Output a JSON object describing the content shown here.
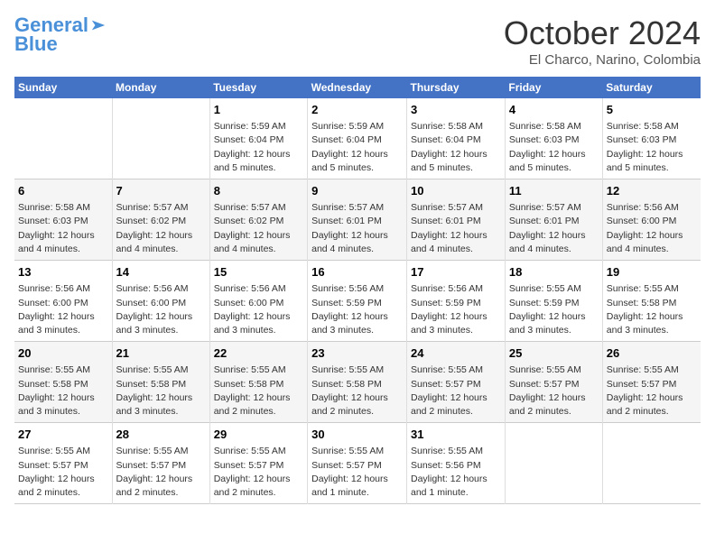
{
  "header": {
    "logo_line1": "General",
    "logo_line2": "Blue",
    "month_title": "October 2024",
    "location": "El Charco, Narino, Colombia"
  },
  "days_of_week": [
    "Sunday",
    "Monday",
    "Tuesday",
    "Wednesday",
    "Thursday",
    "Friday",
    "Saturday"
  ],
  "weeks": [
    [
      {
        "day": "",
        "info": ""
      },
      {
        "day": "",
        "info": ""
      },
      {
        "day": "1",
        "info": "Sunrise: 5:59 AM\nSunset: 6:04 PM\nDaylight: 12 hours and 5 minutes."
      },
      {
        "day": "2",
        "info": "Sunrise: 5:59 AM\nSunset: 6:04 PM\nDaylight: 12 hours and 5 minutes."
      },
      {
        "day": "3",
        "info": "Sunrise: 5:58 AM\nSunset: 6:04 PM\nDaylight: 12 hours and 5 minutes."
      },
      {
        "day": "4",
        "info": "Sunrise: 5:58 AM\nSunset: 6:03 PM\nDaylight: 12 hours and 5 minutes."
      },
      {
        "day": "5",
        "info": "Sunrise: 5:58 AM\nSunset: 6:03 PM\nDaylight: 12 hours and 5 minutes."
      }
    ],
    [
      {
        "day": "6",
        "info": "Sunrise: 5:58 AM\nSunset: 6:03 PM\nDaylight: 12 hours and 4 minutes."
      },
      {
        "day": "7",
        "info": "Sunrise: 5:57 AM\nSunset: 6:02 PM\nDaylight: 12 hours and 4 minutes."
      },
      {
        "day": "8",
        "info": "Sunrise: 5:57 AM\nSunset: 6:02 PM\nDaylight: 12 hours and 4 minutes."
      },
      {
        "day": "9",
        "info": "Sunrise: 5:57 AM\nSunset: 6:01 PM\nDaylight: 12 hours and 4 minutes."
      },
      {
        "day": "10",
        "info": "Sunrise: 5:57 AM\nSunset: 6:01 PM\nDaylight: 12 hours and 4 minutes."
      },
      {
        "day": "11",
        "info": "Sunrise: 5:57 AM\nSunset: 6:01 PM\nDaylight: 12 hours and 4 minutes."
      },
      {
        "day": "12",
        "info": "Sunrise: 5:56 AM\nSunset: 6:00 PM\nDaylight: 12 hours and 4 minutes."
      }
    ],
    [
      {
        "day": "13",
        "info": "Sunrise: 5:56 AM\nSunset: 6:00 PM\nDaylight: 12 hours and 3 minutes."
      },
      {
        "day": "14",
        "info": "Sunrise: 5:56 AM\nSunset: 6:00 PM\nDaylight: 12 hours and 3 minutes."
      },
      {
        "day": "15",
        "info": "Sunrise: 5:56 AM\nSunset: 6:00 PM\nDaylight: 12 hours and 3 minutes."
      },
      {
        "day": "16",
        "info": "Sunrise: 5:56 AM\nSunset: 5:59 PM\nDaylight: 12 hours and 3 minutes."
      },
      {
        "day": "17",
        "info": "Sunrise: 5:56 AM\nSunset: 5:59 PM\nDaylight: 12 hours and 3 minutes."
      },
      {
        "day": "18",
        "info": "Sunrise: 5:55 AM\nSunset: 5:59 PM\nDaylight: 12 hours and 3 minutes."
      },
      {
        "day": "19",
        "info": "Sunrise: 5:55 AM\nSunset: 5:58 PM\nDaylight: 12 hours and 3 minutes."
      }
    ],
    [
      {
        "day": "20",
        "info": "Sunrise: 5:55 AM\nSunset: 5:58 PM\nDaylight: 12 hours and 3 minutes."
      },
      {
        "day": "21",
        "info": "Sunrise: 5:55 AM\nSunset: 5:58 PM\nDaylight: 12 hours and 3 minutes."
      },
      {
        "day": "22",
        "info": "Sunrise: 5:55 AM\nSunset: 5:58 PM\nDaylight: 12 hours and 2 minutes."
      },
      {
        "day": "23",
        "info": "Sunrise: 5:55 AM\nSunset: 5:58 PM\nDaylight: 12 hours and 2 minutes."
      },
      {
        "day": "24",
        "info": "Sunrise: 5:55 AM\nSunset: 5:57 PM\nDaylight: 12 hours and 2 minutes."
      },
      {
        "day": "25",
        "info": "Sunrise: 5:55 AM\nSunset: 5:57 PM\nDaylight: 12 hours and 2 minutes."
      },
      {
        "day": "26",
        "info": "Sunrise: 5:55 AM\nSunset: 5:57 PM\nDaylight: 12 hours and 2 minutes."
      }
    ],
    [
      {
        "day": "27",
        "info": "Sunrise: 5:55 AM\nSunset: 5:57 PM\nDaylight: 12 hours and 2 minutes."
      },
      {
        "day": "28",
        "info": "Sunrise: 5:55 AM\nSunset: 5:57 PM\nDaylight: 12 hours and 2 minutes."
      },
      {
        "day": "29",
        "info": "Sunrise: 5:55 AM\nSunset: 5:57 PM\nDaylight: 12 hours and 2 minutes."
      },
      {
        "day": "30",
        "info": "Sunrise: 5:55 AM\nSunset: 5:57 PM\nDaylight: 12 hours and 1 minute."
      },
      {
        "day": "31",
        "info": "Sunrise: 5:55 AM\nSunset: 5:56 PM\nDaylight: 12 hours and 1 minute."
      },
      {
        "day": "",
        "info": ""
      },
      {
        "day": "",
        "info": ""
      }
    ]
  ]
}
